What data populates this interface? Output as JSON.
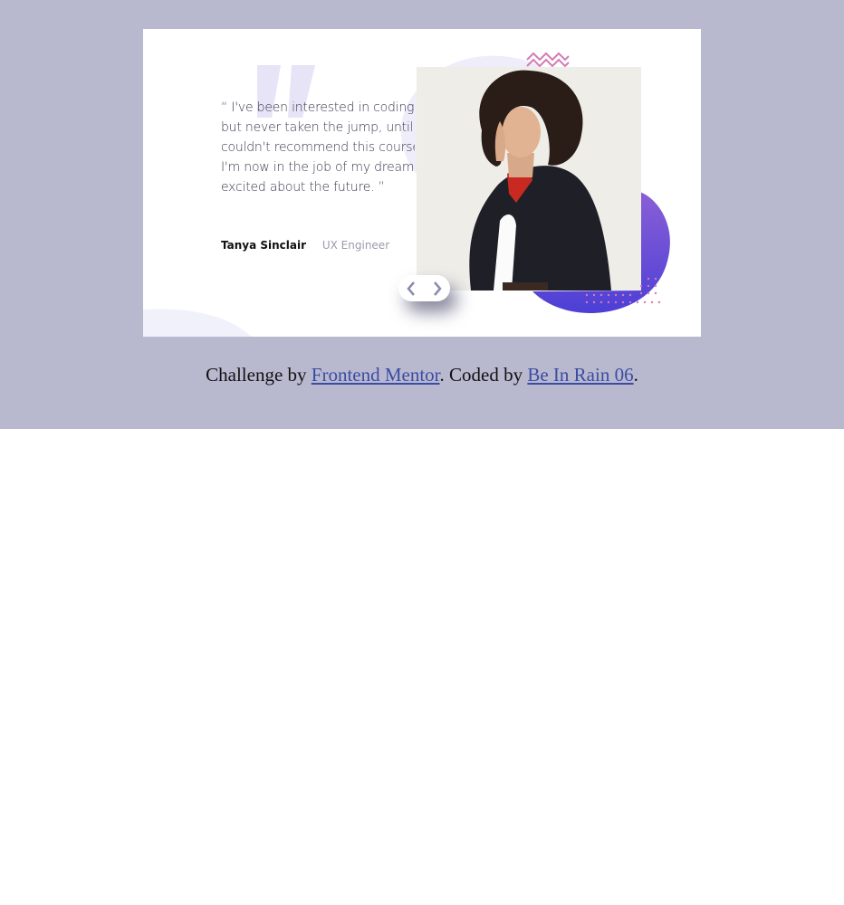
{
  "testimonial": {
    "quote": "“ I've been interested in coding for a while but never taken the jump, until now. I couldn't recommend this course enough. I'm now in the job of my dreams and so excited about the future. ”",
    "author_name": "Tanya Sinclair",
    "author_role": "UX Engineer",
    "photo_alt": "Tanya Sinclair"
  },
  "navigation": {
    "prev_icon": "chevron-left-icon",
    "next_icon": "chevron-right-icon"
  },
  "footer": {
    "prefix": "Challenge by ",
    "link1": "Frontend Mentor",
    "middle": ". Coded by ",
    "link2": "Be In Rain 06",
    "suffix": "."
  },
  "colors": {
    "page_band": "#b8b9cf",
    "accent_purple": "#5b48d8",
    "accent_pink": "#d47ab6",
    "quote_mark": "#e6e4f6"
  }
}
